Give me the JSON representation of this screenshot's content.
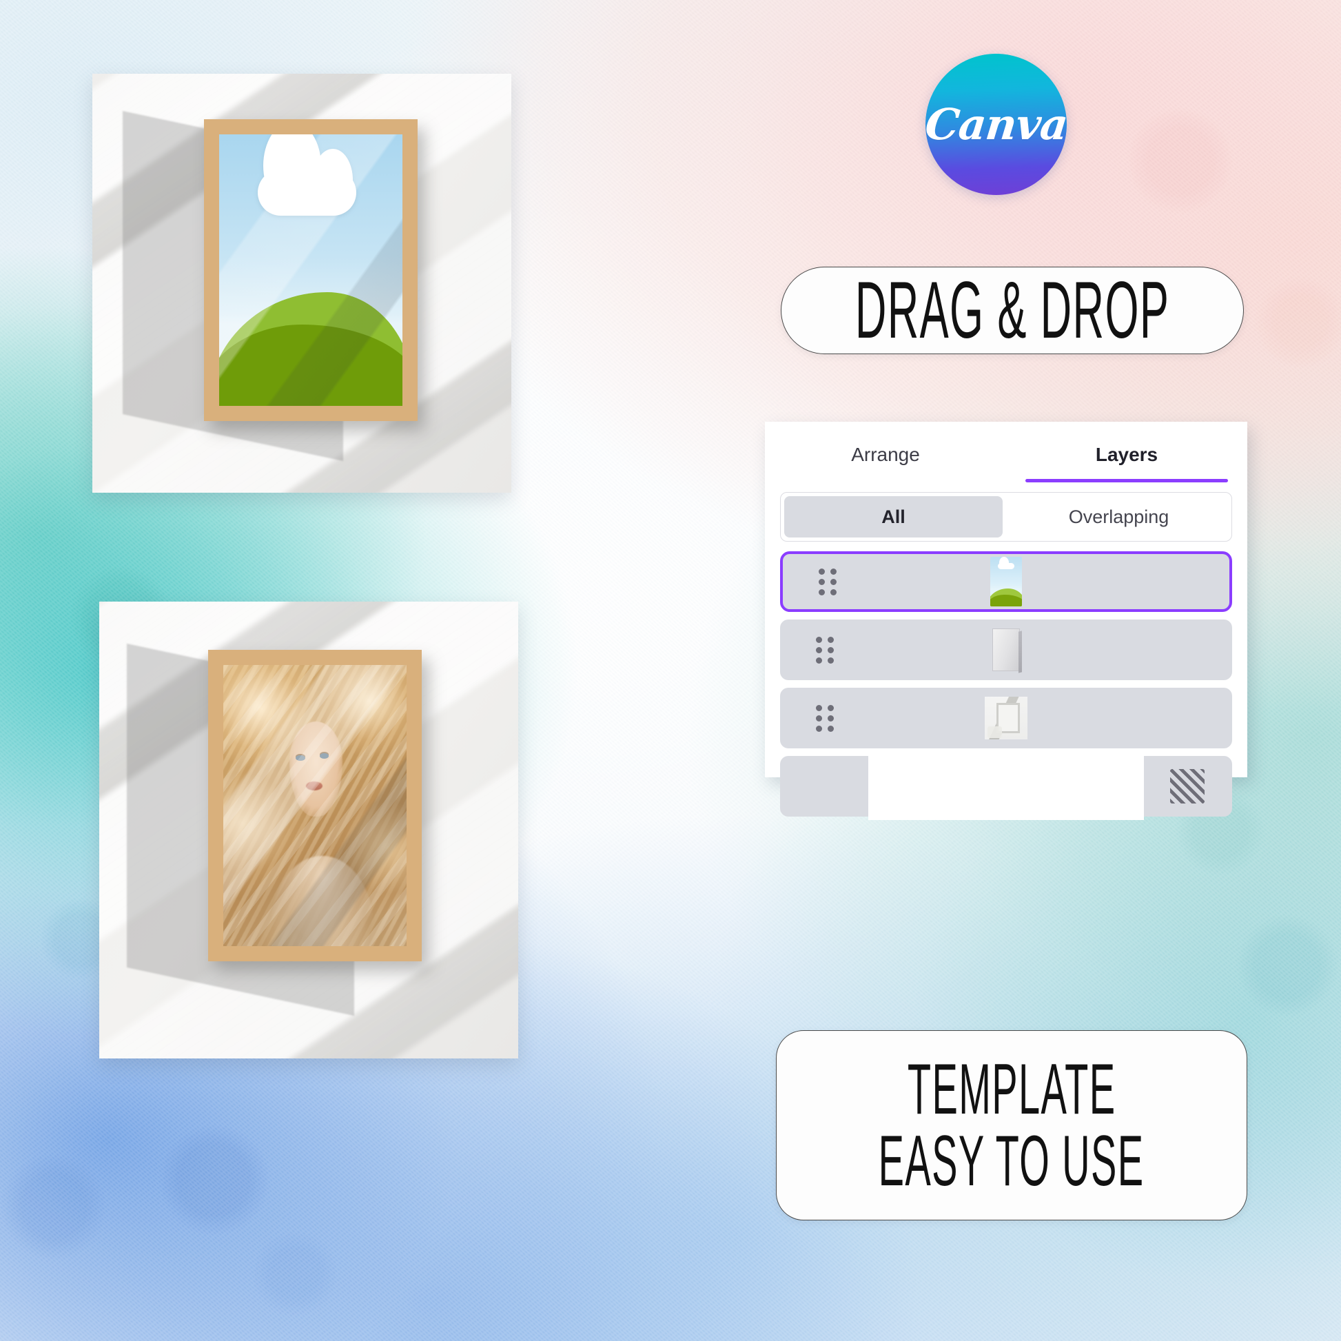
{
  "brand": {
    "logo_text": "Canva",
    "logo_gradient_from": "#00c4cc",
    "logo_gradient_to": "#6f3fd6",
    "accent_purple": "#8b3dff"
  },
  "badges": {
    "drag_drop": "DRAG & DROP",
    "template_line1": "TEMPLATE",
    "template_line2": "EASY TO USE"
  },
  "layers_panel": {
    "tabs": [
      {
        "label": "Arrange",
        "active": false
      },
      {
        "label": "Layers",
        "active": true
      }
    ],
    "filter": {
      "options": [
        {
          "label": "All",
          "selected": true
        },
        {
          "label": "Overlapping",
          "selected": false
        }
      ]
    },
    "rows": [
      {
        "thumbnail": "landscape-art-thumbnail",
        "selected": true,
        "has_handle": true,
        "has_pattern_icon": false
      },
      {
        "thumbnail": "frame-shadow-thumbnail",
        "selected": false,
        "has_handle": true,
        "has_pattern_icon": false
      },
      {
        "thumbnail": "room-mockup-thumbnail",
        "selected": false,
        "has_handle": true,
        "has_pattern_icon": false
      },
      {
        "thumbnail": "white-background-swatch",
        "selected": false,
        "has_handle": false,
        "has_pattern_icon": true
      }
    ]
  },
  "mockups": [
    {
      "name": "framed-landscape-mockup",
      "artwork": "minimal-landscape-blue-sky-white-cloud-green-hills",
      "frame": "light-wood-frame",
      "wall": "white-wall-with-window-light-shadows"
    },
    {
      "name": "framed-portrait-mockup",
      "artwork": "blonde-woman-flowing-hair-portrait",
      "frame": "light-wood-frame",
      "wall": "white-wall-with-window-light-shadows"
    }
  ],
  "background": {
    "style": "watercolor-wash",
    "colors": [
      "#f9dcdc",
      "#f9ccc4",
      "#96d6ce",
      "#7bc9d5",
      "#3ac4c4",
      "#6096e2",
      "#a2cbee"
    ]
  }
}
